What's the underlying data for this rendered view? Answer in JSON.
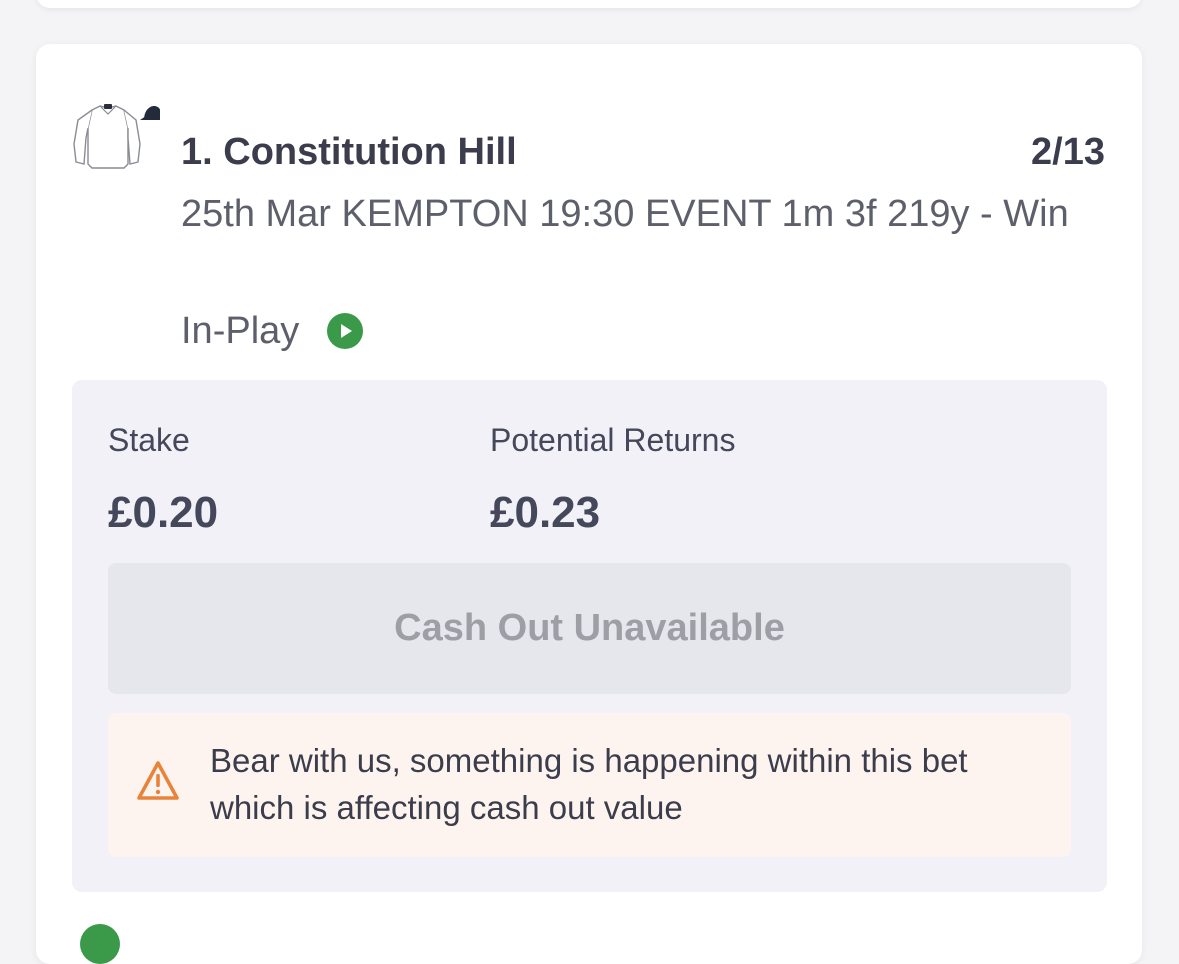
{
  "selection": {
    "runner_name": "1. Constitution Hill",
    "odds": "2/13",
    "event_line": "25th Mar KEMPTON 19:30 EVENT 1m 3f 219y - Win",
    "status": "In-Play"
  },
  "bet": {
    "stake_label": "Stake",
    "stake_value": "£0.20",
    "returns_label": "Potential Returns",
    "returns_value": "£0.23",
    "cashout_label": "Cash Out Unavailable",
    "warning_text": "Bear with us, something is happening within this bet which is affecting cash out value"
  },
  "colors": {
    "accent_green": "#3a9a4a",
    "warning_orange": "#e8843a",
    "warning_bg": "#fdf4ef",
    "panel_bg": "#f1f1f7"
  },
  "icons": {
    "silks": "jockey-silks-icon",
    "play": "play-circle-icon",
    "warning": "warning-triangle-icon"
  }
}
